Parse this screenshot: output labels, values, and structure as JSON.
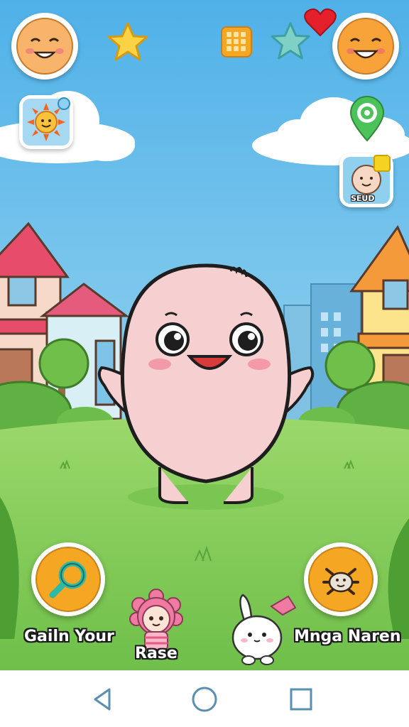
{
  "game": {
    "left_action_label": "Gailn Your",
    "right_action_label": "Mnga Naren",
    "center_pet_label": "Rase",
    "badge_label": "SEUD"
  },
  "icons": {
    "top_left_avatar": "smiling-face-icon",
    "top_right_avatar": "laughing-face-icon",
    "star_gold": "star-icon",
    "star_teal": "star-icon",
    "heart": "heart-icon",
    "calendar": "calendar-grid-icon",
    "sun_tile": "sun-icon",
    "location_pin": "location-pin-icon",
    "left_action": "magnifier-icon",
    "right_action": "bug-icon"
  },
  "colors": {
    "sky_top": "#5bb8ea",
    "sky_bottom": "#a9ddf2",
    "grass": "#8ed163",
    "pet_body": "#f6d0d0",
    "action_orange": "#f5a623"
  }
}
